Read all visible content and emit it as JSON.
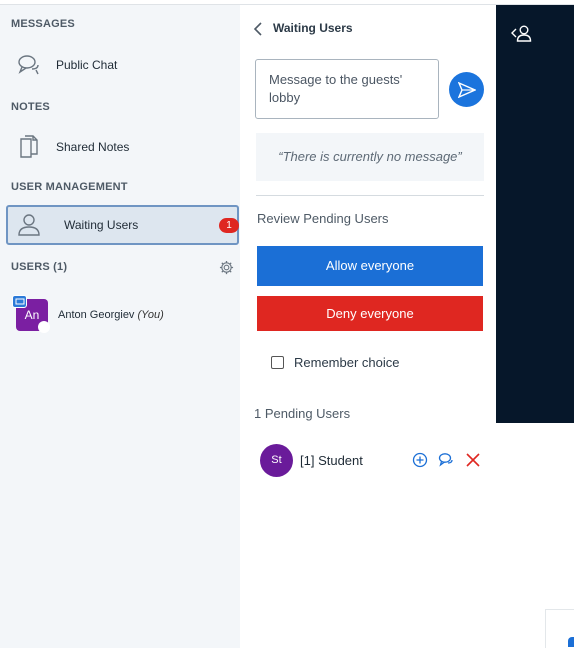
{
  "sidebar": {
    "messages_title": "MESSAGES",
    "public_chat": "Public Chat",
    "notes_title": "NOTES",
    "shared_notes": "Shared Notes",
    "user_mgmt_title": "USER MANAGEMENT",
    "waiting_users": "Waiting Users",
    "waiting_badge": "1",
    "users_title": "USERS (1)",
    "user": {
      "initials": "An",
      "name": "Anton Georgiev",
      "you": "(You)"
    }
  },
  "panel": {
    "title": "Waiting Users",
    "message_text": "Message to the guests' lobby",
    "no_message": "“There is currently no message”",
    "review_label": "Review Pending Users",
    "allow_label": "Allow everyone",
    "deny_label": "Deny everyone",
    "remember_label": "Remember choice",
    "pending_count": "1 Pending Users",
    "pending_users": [
      {
        "initials": "St",
        "name": "[1] Student"
      }
    ]
  },
  "colors": {
    "primary": "#1b6fd6",
    "danger": "#df2721",
    "dark_bg": "#06172a",
    "avatar_purple": "#7b1fa2"
  },
  "icons": [
    "chat-icon",
    "notes-icon",
    "user-icon",
    "gear-icon",
    "chevron-left-icon",
    "send-icon",
    "add-icon",
    "private-chat-icon",
    "close-icon",
    "user-list-toggle-icon"
  ]
}
